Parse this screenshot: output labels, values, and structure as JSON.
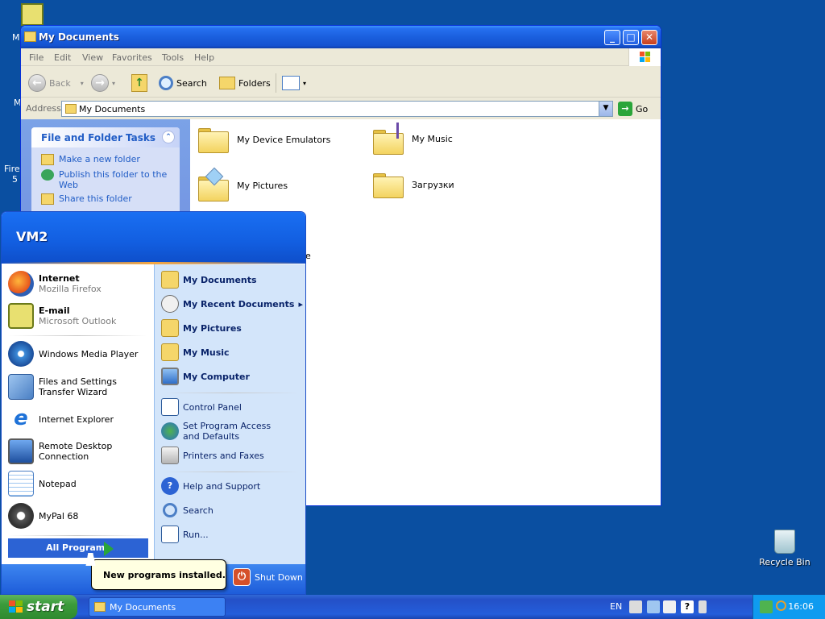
{
  "desktop": {
    "icons": [
      {
        "label": "M",
        "icon": "outlook-icon"
      },
      {
        "label": "M",
        "icon": "computer-icon"
      },
      {
        "label": "Fire",
        "icon": "firefox-icon"
      },
      {
        "label": "Recycle Bin",
        "icon": "recycle-bin-icon"
      }
    ],
    "icon_frag_2": "5"
  },
  "window": {
    "title": "My Documents",
    "controls": {
      "minimize": "_",
      "maximize": "□",
      "close": "✕"
    },
    "menu": [
      "File",
      "Edit",
      "View",
      "Favorites",
      "Tools",
      "Help"
    ],
    "toolbar": {
      "back": "Back",
      "search": "Search",
      "folders": "Folders"
    },
    "address": {
      "label": "Address",
      "value": "My Documents",
      "go": "Go"
    },
    "tasks": {
      "heading": "File and Folder Tasks",
      "items": [
        "Make a new folder",
        "Publish this folder to the Web",
        "Share this folder"
      ]
    },
    "files": [
      {
        "name": "My Device Emulators",
        "icon": "folder-icon"
      },
      {
        "name": "My Music",
        "icon": "music-folder-icon"
      },
      {
        "name": "My Pictures",
        "icon": "pictures-folder-icon"
      },
      {
        "name": "Загрузки",
        "icon": "folder-icon"
      }
    ],
    "hidden_fragment": "e"
  },
  "start_menu": {
    "user": "VM2",
    "pinned": [
      {
        "title": "Internet",
        "subtitle": "Mozilla Firefox",
        "icon": "firefox-icon"
      },
      {
        "title": "E-mail",
        "subtitle": "Microsoft Outlook",
        "icon": "outlook-icon"
      }
    ],
    "recent": [
      {
        "label": "Windows Media Player",
        "icon": "media-player-icon"
      },
      {
        "label": "Files and Settings Transfer Wizard",
        "icon": "transfer-wizard-icon"
      },
      {
        "label": "Internet Explorer",
        "icon": "internet-explorer-icon"
      },
      {
        "label": "Remote Desktop Connection",
        "icon": "remote-desktop-icon"
      },
      {
        "label": "Notepad",
        "icon": "notepad-icon"
      },
      {
        "label": "MyPal 68",
        "icon": "mypal-icon"
      }
    ],
    "all_programs": "All Programs",
    "right_primary": [
      {
        "label": "My Documents",
        "icon": "documents-folder-icon"
      },
      {
        "label": "My Recent Documents",
        "icon": "recent-documents-icon"
      },
      {
        "label": "My Pictures",
        "icon": "pictures-folder-icon"
      },
      {
        "label": "My Music",
        "icon": "music-folder-icon"
      },
      {
        "label": "My Computer",
        "icon": "computer-icon"
      }
    ],
    "right_secondary": [
      {
        "label": "Control Panel",
        "icon": "control-panel-icon"
      },
      {
        "label": "Set Program Access and Defaults",
        "icon": "program-defaults-icon"
      },
      {
        "label": "Printers and Faxes",
        "icon": "printer-icon"
      }
    ],
    "right_tertiary": [
      {
        "label": "Help and Support",
        "icon": "help-icon"
      },
      {
        "label": "Search",
        "icon": "search-icon"
      },
      {
        "label": "Run...",
        "icon": "run-icon"
      }
    ],
    "shutdown": "Shut Down",
    "arrow": "▸"
  },
  "tooltip": "New programs installed.",
  "taskbar": {
    "start": "start",
    "window_button": "My Documents",
    "language": "EN",
    "clock": "16:06"
  }
}
